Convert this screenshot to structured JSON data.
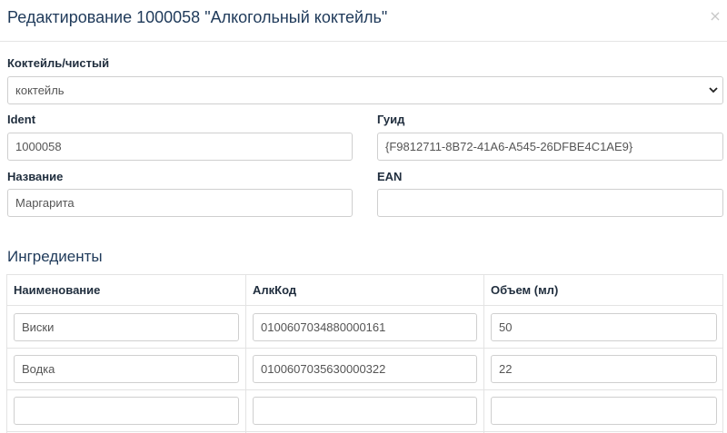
{
  "header": {
    "title": "Редактирование 1000058 \"Алкогольный коктейль\"",
    "close_glyph": "×"
  },
  "form": {
    "type_label": "Коктейль/чистый",
    "type_value": "коктейль",
    "ident_label": "Ident",
    "ident_value": "1000058",
    "guid_label": "Гуид",
    "guid_value": "{F9812711-8B72-41A6-A545-26DFBE4C1AE9}",
    "name_label": "Название",
    "name_value": "Маргарита",
    "ean_label": "EAN",
    "ean_value": ""
  },
  "ingredients": {
    "title": "Ингредиенты",
    "columns": [
      "Наименование",
      "АлкКод",
      "Объем (мл)"
    ],
    "rows": [
      {
        "name": "Виски",
        "code": "0100607034880000161",
        "volume": "50"
      },
      {
        "name": "Водка",
        "code": "0100607035630000322",
        "volume": "22"
      },
      {
        "name": "",
        "code": "",
        "volume": ""
      }
    ]
  }
}
